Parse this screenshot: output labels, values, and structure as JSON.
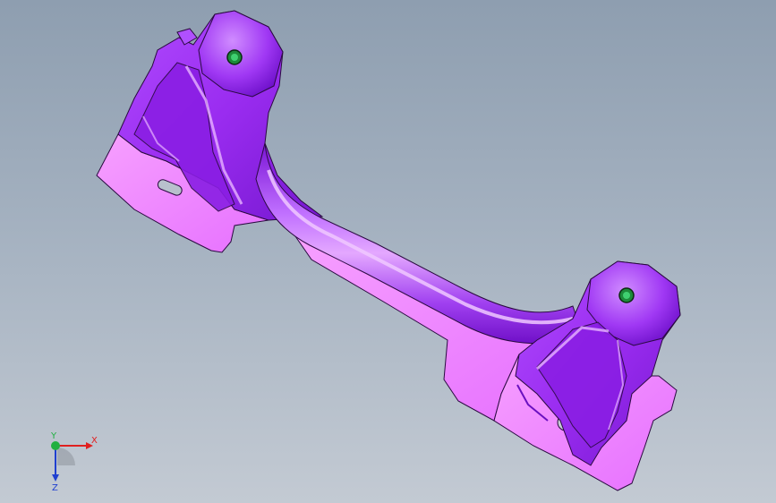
{
  "viewport": {
    "background_top": "#8e9eb0",
    "background_bottom": "#c3cad3"
  },
  "model": {
    "name": "",
    "face_color": "#9a2cf0",
    "face_light": "#d98cff",
    "face_dark": "#6a10c0",
    "flange_color": "#f28cff",
    "edge_color": "#2a0a40",
    "hole_color": "#1d8a3a"
  },
  "triad": {
    "x_label": "X",
    "y_label": "Y",
    "z_label": "Z",
    "x_color": "#e02020",
    "y_color": "#20b040",
    "z_color": "#2040d0"
  }
}
